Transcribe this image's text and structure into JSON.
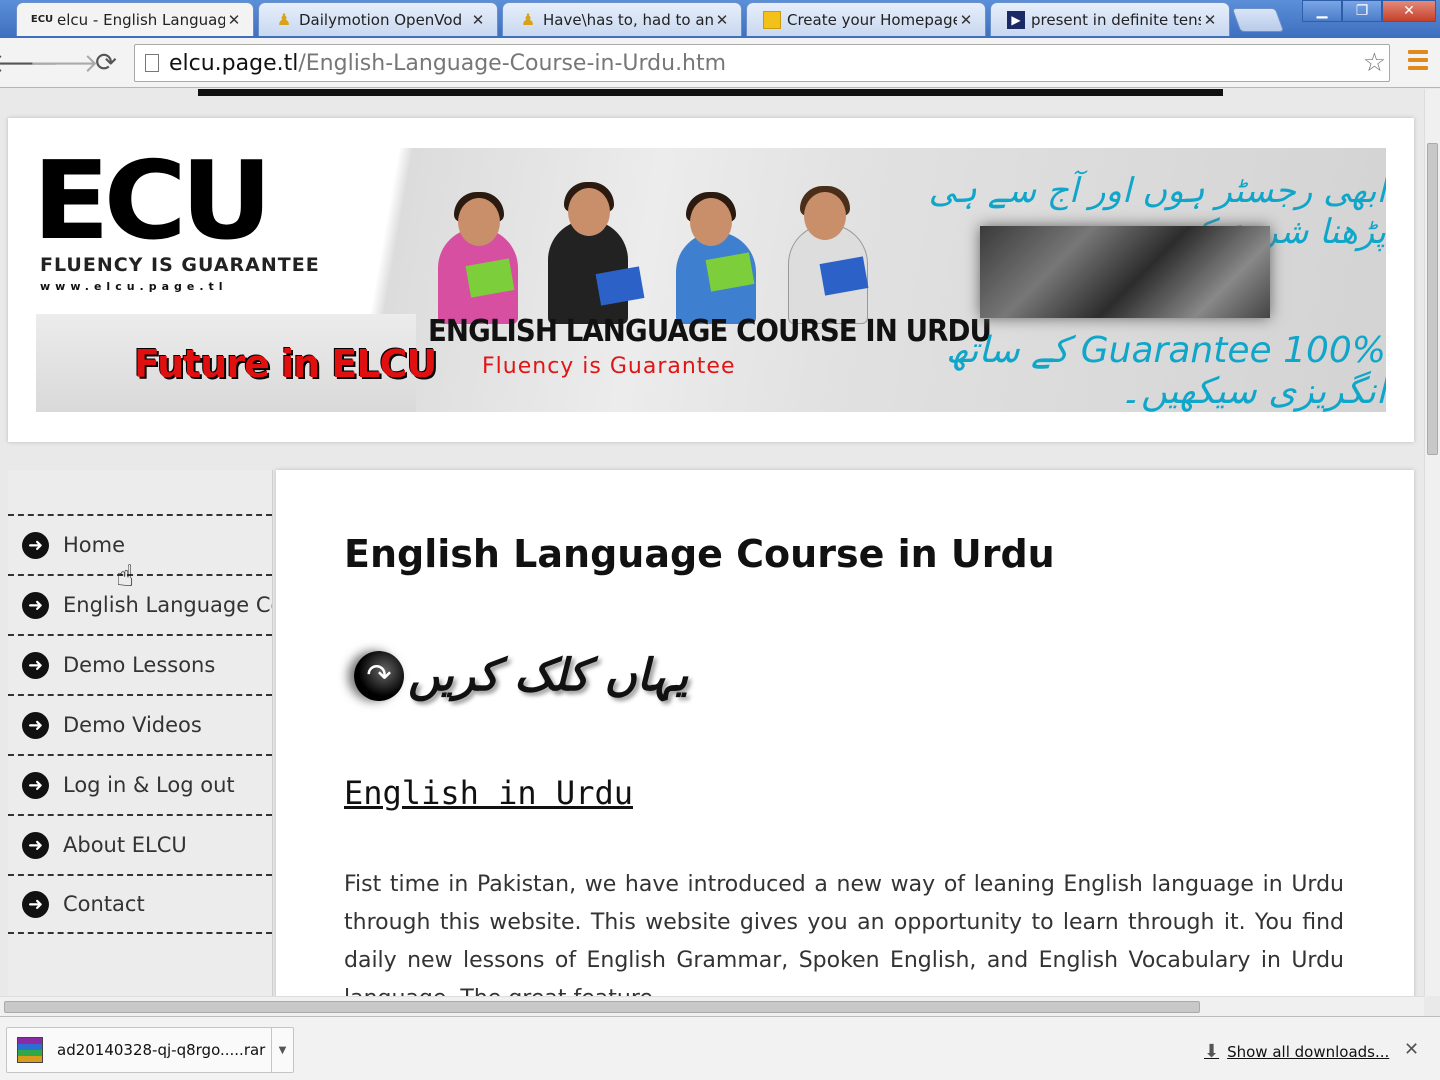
{
  "tabs": [
    {
      "title": "elcu - English Language C",
      "favicon": "ECU",
      "active": true
    },
    {
      "title": "Dailymotion OpenVod",
      "favicon": "person-icon",
      "active": false
    },
    {
      "title": "Have\\has to, had to and",
      "favicon": "person-icon",
      "active": false
    },
    {
      "title": "Create your Homepage f",
      "favicon": "folder-icon",
      "active": false
    },
    {
      "title": "present in definite tense",
      "favicon": "play-icon",
      "active": false
    }
  ],
  "address": {
    "host": "elcu.page.tl",
    "path": "/English-Language-Course-in-Urdu.htm"
  },
  "banner": {
    "logo": "ECU",
    "logo_sub": "FLUENCY IS GUARANTEE",
    "logo_url": "www.elcu.page.tl",
    "future": "Future in ELCU",
    "course_title": "ENGLISH LANGUAGE COURSE IN URDU",
    "course_sub": "Fluency is Guarantee",
    "urdu_top": "ابھی رجسٹر ہوں اور آج سے ہی پڑھنا شروع کریں۔",
    "urdu_bottom": "100% Guarantee کے ساتھ انگریزی سیکھیں۔"
  },
  "sidebar": {
    "items": [
      {
        "label": "Home"
      },
      {
        "label": "English Language Course in Urdu"
      },
      {
        "label": "Demo Lessons"
      },
      {
        "label": "Demo Videos"
      },
      {
        "label": "Log in & Log out"
      },
      {
        "label": "About ELCU"
      },
      {
        "label": "Contact"
      }
    ]
  },
  "content": {
    "title": "English Language Course in Urdu",
    "click_here": "یہاں کلک کریں",
    "subheading": "English in Urdu",
    "paragraph": "Fist time in Pakistan, we have introduced a new way of leaning English language in Urdu through this website. This website gives you an opportunity to learn through it. You find daily new lessons of English Grammar, Spoken English, and English Vocabulary in Urdu language. The great feature"
  },
  "downloads": {
    "file": "ad20140328-qj-q8rgo.....rar",
    "show_all": "Show all downloads..."
  },
  "colors": {
    "accent_red": "#e01010",
    "urdu_blue": "#10a6c9"
  }
}
